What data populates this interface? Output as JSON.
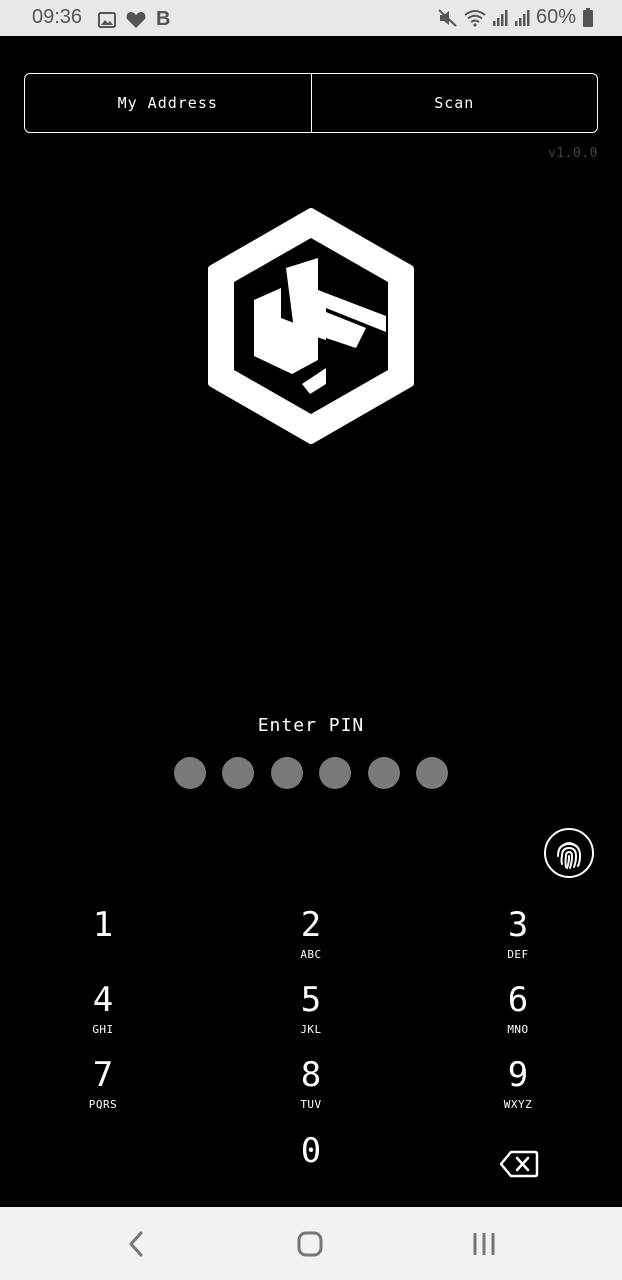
{
  "status_bar": {
    "time": "09:36",
    "battery": "60%",
    "left_icons": [
      "image-icon",
      "heart-icon",
      "b-app-icon"
    ],
    "right_icons": [
      "mute-icon",
      "wifi-icon",
      "signal-icon",
      "signal-icon",
      "battery-icon"
    ]
  },
  "tabs": {
    "my_address": "My Address",
    "scan": "Scan"
  },
  "version": "v1.0.0",
  "pin": {
    "label": "Enter PIN",
    "length": 6,
    "dot_color": "#7a7a7a"
  },
  "keypad": [
    {
      "digit": "1",
      "letters": ""
    },
    {
      "digit": "2",
      "letters": "ABC"
    },
    {
      "digit": "3",
      "letters": "DEF"
    },
    {
      "digit": "4",
      "letters": "GHI"
    },
    {
      "digit": "5",
      "letters": "JKL"
    },
    {
      "digit": "6",
      "letters": "MNO"
    },
    {
      "digit": "7",
      "letters": "PQRS"
    },
    {
      "digit": "8",
      "letters": "TUV"
    },
    {
      "digit": "9",
      "letters": "WXYZ"
    },
    {
      "digit": "0",
      "letters": ""
    }
  ],
  "icons": {
    "logo": "hexagon-s-logo",
    "fingerprint": "fingerprint-icon",
    "backspace": "backspace-icon",
    "nav": [
      "back-icon",
      "home-icon",
      "recents-icon"
    ]
  }
}
